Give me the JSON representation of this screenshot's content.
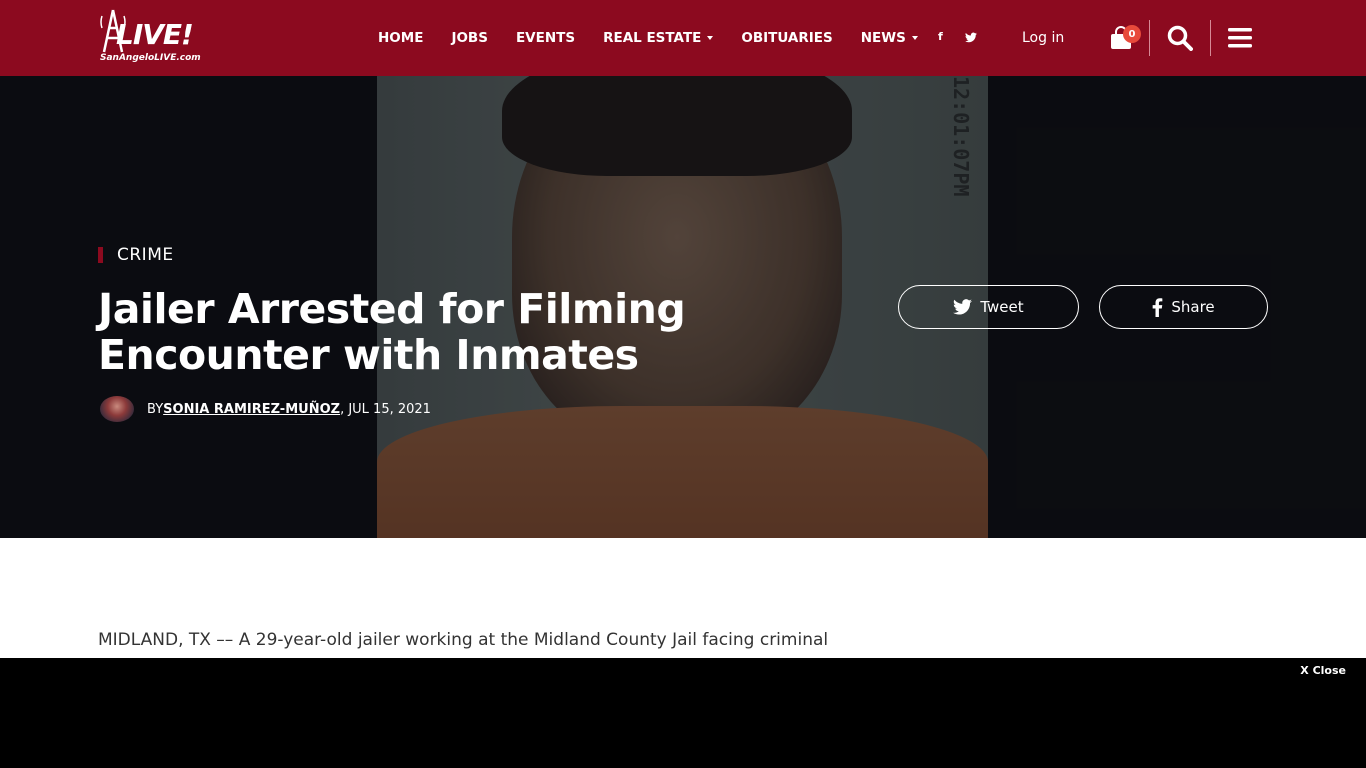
{
  "logo": {
    "main": "LIVE!",
    "sub": "SanAngeloLIVE.com"
  },
  "nav": {
    "items": [
      {
        "label": "HOME",
        "dropdown": false
      },
      {
        "label": "JOBS",
        "dropdown": false
      },
      {
        "label": "EVENTS",
        "dropdown": false
      },
      {
        "label": "REAL ESTATE",
        "dropdown": true
      },
      {
        "label": "OBITUARIES",
        "dropdown": false
      },
      {
        "label": "NEWS",
        "dropdown": true
      }
    ]
  },
  "header": {
    "facebook_glyph": "f",
    "login_label": "Log in",
    "cart_count": "0"
  },
  "article": {
    "category": "CRIME",
    "title": "Jailer Arrested for Filming Encounter with Inmates",
    "byline_prefix": "BY ",
    "author": "SONIA RAMIREZ-MUÑOZ",
    "date": ", JUL 15, 2021",
    "lede": "MIDLAND, TX –– A 29-year-old jailer working at the Midland County Jail facing criminal",
    "photo_stamp": "12:01:07PM"
  },
  "share": {
    "tweet_label": "Tweet",
    "share_label": "Share"
  },
  "ad": {
    "close_label": "X Close"
  },
  "colors": {
    "brand": "#8c0a1f",
    "badge": "#e84a3b",
    "hero_bg": "#0d0e13"
  }
}
